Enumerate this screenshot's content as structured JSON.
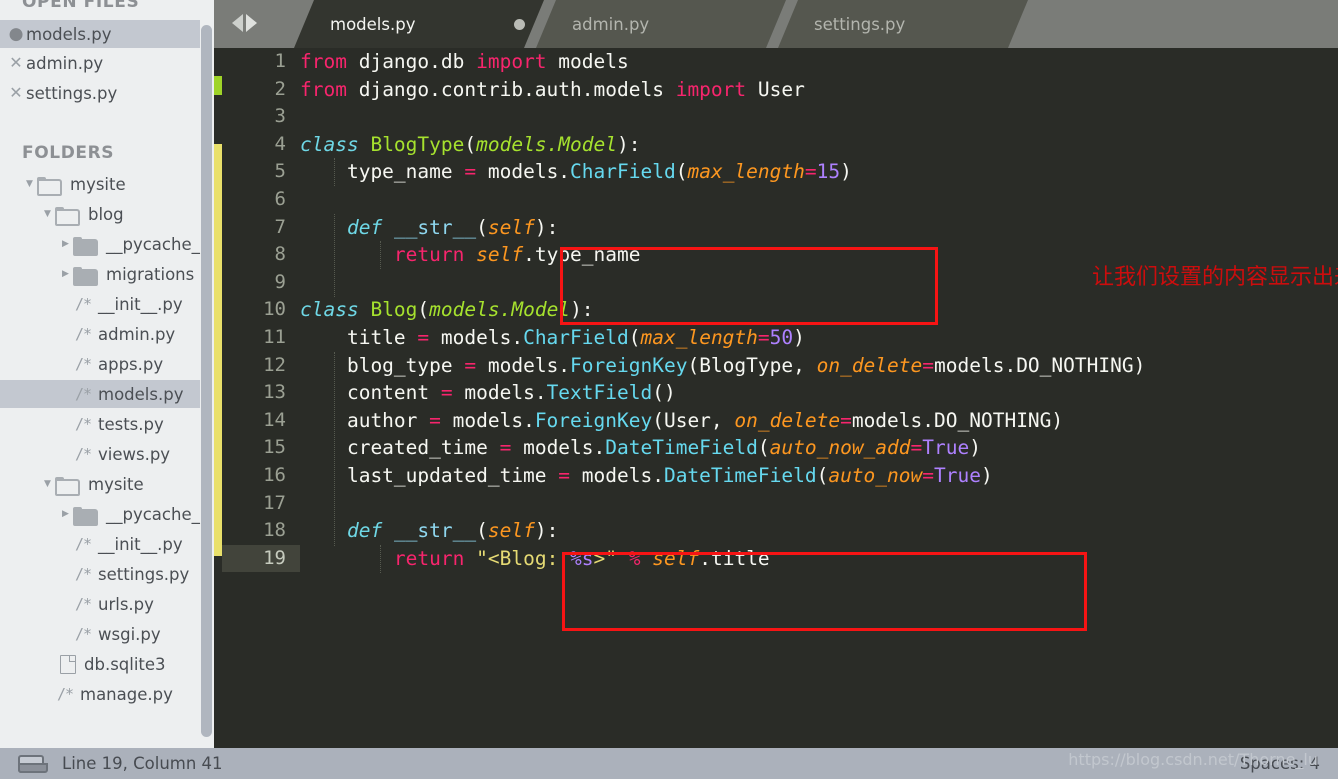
{
  "window": {
    "editor_bg": "#2a2c27",
    "sidebar_bg": "#edeff0",
    "accent_red": "#f61414"
  },
  "sidebar": {
    "open_files_title": "OPEN FILES",
    "folders_title": "FOLDERS",
    "open_files": [
      {
        "label": "models.py",
        "icon": "dot-icon",
        "selected": true
      },
      {
        "label": "admin.py",
        "icon": "close-icon",
        "selected": false
      },
      {
        "label": "settings.py",
        "icon": "close-icon",
        "selected": false
      }
    ],
    "folders": [
      {
        "label": "mysite",
        "icon": "folder-open-icon",
        "arrow": "chevron-down-icon",
        "indent": 0,
        "selected": false
      },
      {
        "label": "blog",
        "icon": "folder-open-icon",
        "arrow": "chevron-down-icon",
        "indent": 1,
        "selected": false
      },
      {
        "label": "__pycache_",
        "icon": "folder-closed-icon",
        "arrow": "chevron-right-icon",
        "indent": 2,
        "selected": false
      },
      {
        "label": "migrations",
        "icon": "folder-closed-icon",
        "arrow": "chevron-right-icon",
        "indent": 2,
        "selected": false
      },
      {
        "label": "__init__.py",
        "icon": "python-file-icon",
        "arrow": "",
        "indent": 3,
        "selected": false
      },
      {
        "label": "admin.py",
        "icon": "python-file-icon",
        "arrow": "",
        "indent": 3,
        "selected": false
      },
      {
        "label": "apps.py",
        "icon": "python-file-icon",
        "arrow": "",
        "indent": 3,
        "selected": false
      },
      {
        "label": "models.py",
        "icon": "python-file-icon",
        "arrow": "",
        "indent": 3,
        "selected": true
      },
      {
        "label": "tests.py",
        "icon": "python-file-icon",
        "arrow": "",
        "indent": 3,
        "selected": false
      },
      {
        "label": "views.py",
        "icon": "python-file-icon",
        "arrow": "",
        "indent": 3,
        "selected": false
      },
      {
        "label": "mysite",
        "icon": "folder-open-icon",
        "arrow": "chevron-down-icon",
        "indent": 1,
        "selected": false
      },
      {
        "label": "__pycache_",
        "icon": "folder-closed-icon",
        "arrow": "chevron-right-icon",
        "indent": 2,
        "selected": false
      },
      {
        "label": "__init__.py",
        "icon": "python-file-icon",
        "arrow": "",
        "indent": 3,
        "selected": false
      },
      {
        "label": "settings.py",
        "icon": "python-file-icon",
        "arrow": "",
        "indent": 3,
        "selected": false
      },
      {
        "label": "urls.py",
        "icon": "python-file-icon",
        "arrow": "",
        "indent": 3,
        "selected": false
      },
      {
        "label": "wsgi.py",
        "icon": "python-file-icon",
        "arrow": "",
        "indent": 3,
        "selected": false
      },
      {
        "label": "db.sqlite3",
        "icon": "plain-file-icon",
        "arrow": "",
        "indent": 2,
        "selected": false
      },
      {
        "label": "manage.py",
        "icon": "python-file-icon",
        "arrow": "",
        "indent": 2,
        "selected": false
      }
    ],
    "python_icon_glyph": "/*"
  },
  "tabs": [
    {
      "label": "models.py",
      "active": true,
      "indicator": "unsaved-dot-icon"
    },
    {
      "label": "admin.py",
      "active": false,
      "indicator": "close-icon"
    },
    {
      "label": "settings.py",
      "active": false,
      "indicator": "close-icon"
    }
  ],
  "nav": {
    "back_icon": "triangle-left-icon",
    "forward_icon": "triangle-right-icon"
  },
  "editor": {
    "current_line": 19,
    "line_numbers": [
      1,
      2,
      3,
      4,
      5,
      6,
      7,
      8,
      9,
      10,
      11,
      12,
      13,
      14,
      15,
      16,
      17,
      18,
      19
    ],
    "code": [
      "from django.db import models",
      "from django.contrib.auth.models import User",
      "",
      "class BlogType(models.Model):",
      "    type_name = models.CharField(max_length=15)",
      "",
      "    def __str__(self):",
      "        return self.type_name",
      "",
      "class Blog(models.Model):",
      "    title = models.CharField(max_length=50)",
      "    blog_type = models.ForeignKey(BlogType, on_delete=models.DO_NOTHING)",
      "    content = models.TextField()",
      "    author = models.ForeignKey(User, on_delete=models.DO_NOTHING)",
      "    created_time = models.DateTimeField(auto_now_add=True)",
      "    last_updated_time = models.DateTimeField(auto_now=True)",
      "",
      "    def __str__(self):",
      "        return \"<Blog: %s>\" % self.title"
    ],
    "annotation": "让我们设置的内容显示出来",
    "diff_markers": [
      {
        "color": "#9fd428",
        "label": "added-marker"
      },
      {
        "color": "#e9e06a",
        "label": "modified-marker"
      }
    ]
  },
  "statusbar": {
    "position_label": "Line 19, Column 41",
    "spaces_label": "Spaces: 4",
    "watermark": "https://blog.csdn.net/Thorne_lu",
    "layout_icon": "panel-icon"
  }
}
